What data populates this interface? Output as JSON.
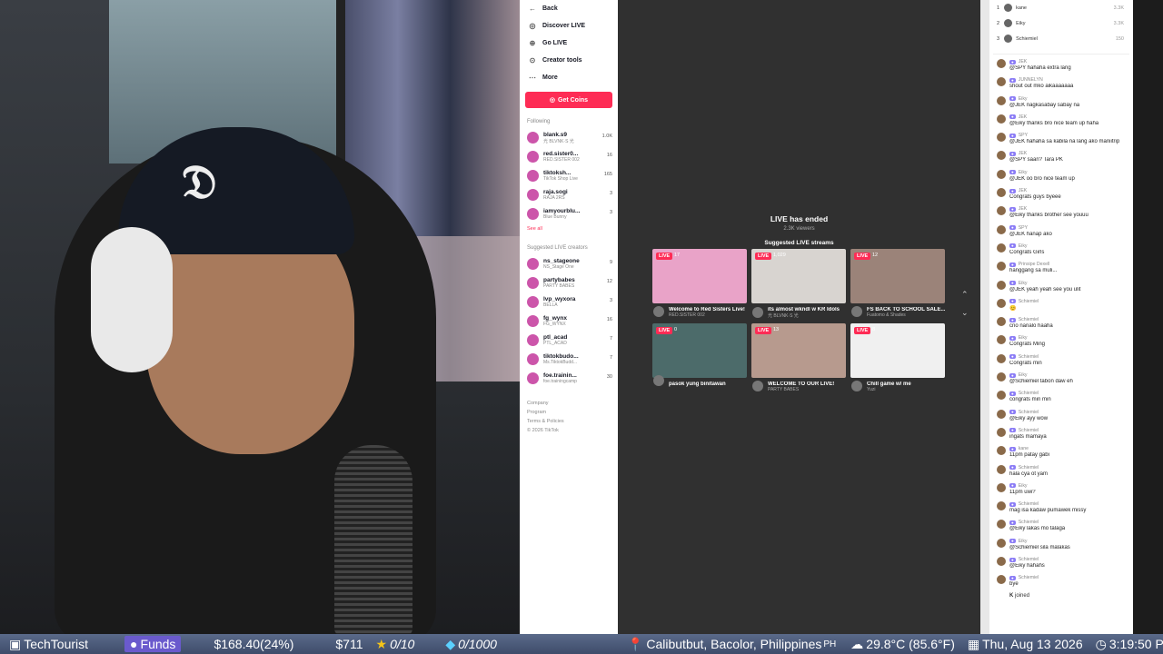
{
  "tiktok": {
    "nav": [
      {
        "icon": "←",
        "label": "Back"
      },
      {
        "icon": "◎",
        "label": "Discover LIVE"
      },
      {
        "icon": "⊕",
        "label": "Go LIVE"
      },
      {
        "icon": "⊙",
        "label": "Creator tools"
      },
      {
        "icon": "⋯",
        "label": "More"
      }
    ],
    "get_coins": "Get Coins",
    "following_title": "Following",
    "following": [
      {
        "name": "blank.s9",
        "sub": "光 BLVNK·S 光",
        "count": "1.0K"
      },
      {
        "name": "red.sister0...",
        "sub": "RED.SISTER 002",
        "count": "16"
      },
      {
        "name": "tiktoksh...",
        "sub": "TikTok Shop Live",
        "count": "165"
      },
      {
        "name": "raja.sogi",
        "sub": "RAJA 2RS",
        "count": "3"
      },
      {
        "name": "iamyourblu...",
        "sub": "Blue Bunny",
        "count": "3"
      }
    ],
    "see_all": "See all",
    "suggested_title": "Suggested LIVE creators",
    "suggested": [
      {
        "name": "ns_stageone",
        "sub": "NS_Stage One",
        "count": "9"
      },
      {
        "name": "partybabes",
        "sub": "PARTY BABES",
        "count": "12"
      },
      {
        "name": "lvp_wyxora",
        "sub": "BELLA",
        "count": "3"
      },
      {
        "name": "fg_wynx",
        "sub": "FG_WYNX",
        "count": "16"
      },
      {
        "name": "ptl_acad",
        "sub": "PTL_ACAD",
        "count": "7"
      },
      {
        "name": "tiktokbudo...",
        "sub": "Ms.TiktokBudd...",
        "count": "7"
      },
      {
        "name": "foe.trainin...",
        "sub": "foe.trainingcamp",
        "count": "30"
      }
    ],
    "footer": [
      "Company",
      "Program",
      "Terms & Policies",
      "© 2026 TikTok"
    ]
  },
  "stream": {
    "ended": "LIVE has ended",
    "viewers": "2.3K viewers",
    "suggested": "Suggested LIVE streams",
    "cards": [
      {
        "live": "LIVE",
        "views": "17",
        "title": "Welcome to Red Sisters Live!",
        "host": "RED.SISTER 002",
        "color": "#e9a3c8"
      },
      {
        "live": "LIVE",
        "views": "1,029",
        "title": "its almost wkndl w KR Idols",
        "host": "光 BLVNK·S 光",
        "color": "#d8d4d0"
      },
      {
        "live": "LIVE",
        "views": "12",
        "title": "FS BACK TO SCHOOL SALE...",
        "host": "Fuatomo & Shades",
        "color": "#9b8379"
      },
      {
        "live": "LIVE",
        "views": "0",
        "title": "pasok yung binitawan",
        "host": "",
        "color": "#4c6b6a"
      },
      {
        "live": "LIVE",
        "views": "13",
        "title": "WELCOME TO OUR LIVE!",
        "host": "PARTY BABES",
        "color": "#b79a8e"
      },
      {
        "live": "LIVE",
        "views": "8",
        "title": "Chill game w/ me",
        "host": "Yuzi",
        "color": "#f0f0f0"
      }
    ]
  },
  "chat": {
    "top": [
      {
        "rank": "1",
        "name": "kane",
        "count": "3.3K"
      },
      {
        "name": "Eiky",
        "rank": "2",
        "count": "3.3K"
      },
      {
        "rank": "3",
        "name": "Schiemiel",
        "count": "150"
      }
    ],
    "messages": [
      {
        "user": "JEK",
        "text": "@SPY hahaha extra lang"
      },
      {
        "user": "JUNNELYN",
        "text": "shout out mko aikaaaaaaa"
      },
      {
        "user": "Eiky",
        "text": "@JEK nagkasabay sabay na"
      },
      {
        "user": "JEK",
        "text": "@Eiky thanks bro nice team up haha"
      },
      {
        "user": "SPY",
        "text": "@JEK hahaha sa kabila na lang ako maniitrip"
      },
      {
        "user": "JEK",
        "text": "@SPY saan? Tara PK"
      },
      {
        "user": "Eiky",
        "text": "@JEK oo bro nice team up"
      },
      {
        "user": "JEK",
        "text": "Congrats guys byeee"
      },
      {
        "user": "JEK",
        "text": "@Eiky thanks brother see youuu"
      },
      {
        "user": "SPY",
        "text": "@JEK hanap ako"
      },
      {
        "user": "Eiky",
        "text": "Congrats Girls"
      },
      {
        "user": "Prinsipe Dexell",
        "text": "hanggang sa muli..."
      },
      {
        "user": "Eiky",
        "text": "@JEK yeah yeah see you ulit"
      },
      {
        "user": "Schiemiel",
        "text": "😊"
      },
      {
        "user": "Schiemiel",
        "text": "cno nanalo haaha"
      },
      {
        "user": "Eiky",
        "text": "Congrats Ming"
      },
      {
        "user": "Schiemiel",
        "text": "Congrats min"
      },
      {
        "user": "Eiky",
        "text": "@Schiemiel tabon daw eh"
      },
      {
        "user": "Schiemiel",
        "text": "congrats min min"
      },
      {
        "user": "Schiemiel",
        "text": "@Eiky ayy wow"
      },
      {
        "user": "Schiemiel",
        "text": "ingats mamaya"
      },
      {
        "user": "kane",
        "text": "11pm patay gabi"
      },
      {
        "user": "Schiemiel",
        "text": "hala cya ot yam"
      },
      {
        "user": "Eiky",
        "text": "11pm uwi?"
      },
      {
        "user": "Schiemiel",
        "text": "mag isa kadaw pumawek missy"
      },
      {
        "user": "Schiemiel",
        "text": "@Eiky lakas mo talaga"
      },
      {
        "user": "Eiky",
        "text": "@Schiemiel sila malakas"
      },
      {
        "user": "Schiemiel",
        "text": "@Eiky hahahs"
      },
      {
        "user": "Schiemiel",
        "text": "bye"
      }
    ],
    "joined_user": "K",
    "joined": "joined"
  },
  "statusbar": {
    "channel": "TechTourist",
    "funds_label": "Funds",
    "funds_value": "$168.40(24%)",
    "amount": "$711",
    "stars": "0/10",
    "gems": "0/1000",
    "location": "Calibutbut, Bacolor, Philippines",
    "country": "PH",
    "temp": "29.8°C (85.6°F)",
    "date": "Thu, Aug 13 2026",
    "time": "3:19:50 PM"
  }
}
